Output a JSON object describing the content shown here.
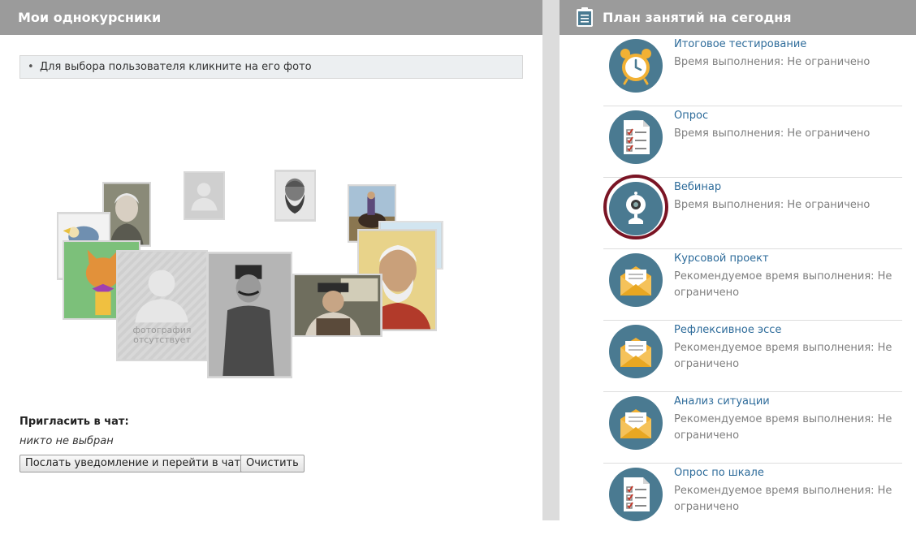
{
  "classmates": {
    "title": "Мои однокурсники",
    "hint": "Для выбора пользователя кликните на его фото",
    "photos": [
      {
        "name": "photo-elderly-woman"
      },
      {
        "name": "photo-placeholder-small"
      },
      {
        "name": "photo-bearded-man"
      },
      {
        "name": "photo-horseman"
      },
      {
        "name": "photo-bird"
      },
      {
        "name": "photo-cartoon-cat"
      },
      {
        "name": "photo-warrior"
      },
      {
        "name": "photo-placeholder-large",
        "text": "фотография отсутствует"
      },
      {
        "name": "photo-soldier"
      },
      {
        "name": "photo-man-cap"
      }
    ],
    "invite_title": "Пригласить в чат:",
    "invite_status": "никто не выбран",
    "notify_button": "Послать уведомление и перейти в чат",
    "clear_button": "Очистить"
  },
  "plan": {
    "title": "План занятий на сегодня",
    "tasks": [
      {
        "title": "Итоговое тестирование",
        "desc": "Время выполнения: Не ограничено",
        "icon": "alarm-clock-icon"
      },
      {
        "title": "Опрос",
        "desc": "Время выполнения: Не ограничено",
        "icon": "checklist-icon"
      },
      {
        "title": "Вебинар",
        "desc": "Время выполнения: Не ограничено",
        "icon": "webcam-icon"
      },
      {
        "title": "Курсовой проект",
        "desc": "Рекомендуемое время выполнения: Не ограничено",
        "icon": "envelope-icon"
      },
      {
        "title": "Рефлексивное эссе",
        "desc": "Рекомендуемое время выполнения: Не ограничено",
        "icon": "envelope-icon"
      },
      {
        "title": "Анализ ситуации",
        "desc": "Рекомендуемое время выполнения: Не ограничено",
        "icon": "envelope-icon"
      },
      {
        "title": "Опрос по шкале",
        "desc": "Рекомендуемое время выполнения: Не ограничено",
        "icon": "checklist-icon"
      }
    ]
  },
  "colors": {
    "header_bg": "#9b9b9b",
    "link": "#2d6b9a",
    "icon_circle": "#4a7a91",
    "highlight": "#7a1424"
  }
}
